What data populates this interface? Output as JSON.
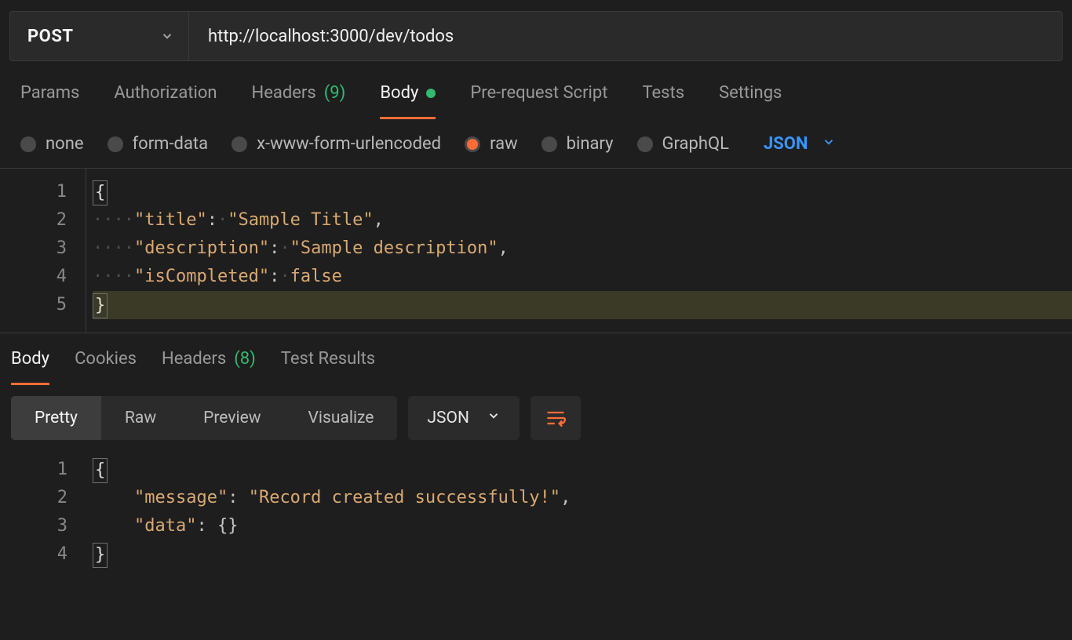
{
  "request": {
    "method": "POST",
    "url": "http://localhost:3000/dev/todos"
  },
  "tabs": {
    "params": "Params",
    "authorization": "Authorization",
    "headers_label": "Headers",
    "headers_count": "(9)",
    "body": "Body",
    "prerequest": "Pre-request Script",
    "tests": "Tests",
    "settings": "Settings"
  },
  "body_types": {
    "none": "none",
    "form_data": "form-data",
    "urlencoded": "x-www-form-urlencoded",
    "raw": "raw",
    "binary": "binary",
    "graphql": "GraphQL",
    "raw_format": "JSON"
  },
  "request_body": {
    "line1_brace": "{",
    "line2_key": "\"title\"",
    "line2_val": "\"Sample Title\"",
    "line3_key": "\"description\"",
    "line3_val": "\"Sample description\"",
    "line4_key": "\"isCompleted\"",
    "line4_val": "false",
    "line5_brace": "}",
    "ln1": "1",
    "ln2": "2",
    "ln3": "3",
    "ln4": "4",
    "ln5": "5"
  },
  "response_tabs": {
    "body": "Body",
    "cookies": "Cookies",
    "headers_label": "Headers",
    "headers_count": "(8)",
    "test_results": "Test Results"
  },
  "response_toolbar": {
    "pretty": "Pretty",
    "raw": "Raw",
    "preview": "Preview",
    "visualize": "Visualize",
    "format": "JSON"
  },
  "response_body": {
    "line1_brace": "{",
    "line2_key": "\"message\"",
    "line2_val": "\"Record created successfully!\"",
    "line3_key": "\"data\"",
    "line3_val": "{}",
    "line4_brace": "}",
    "ln1": "1",
    "ln2": "2",
    "ln3": "3",
    "ln4": "4"
  }
}
